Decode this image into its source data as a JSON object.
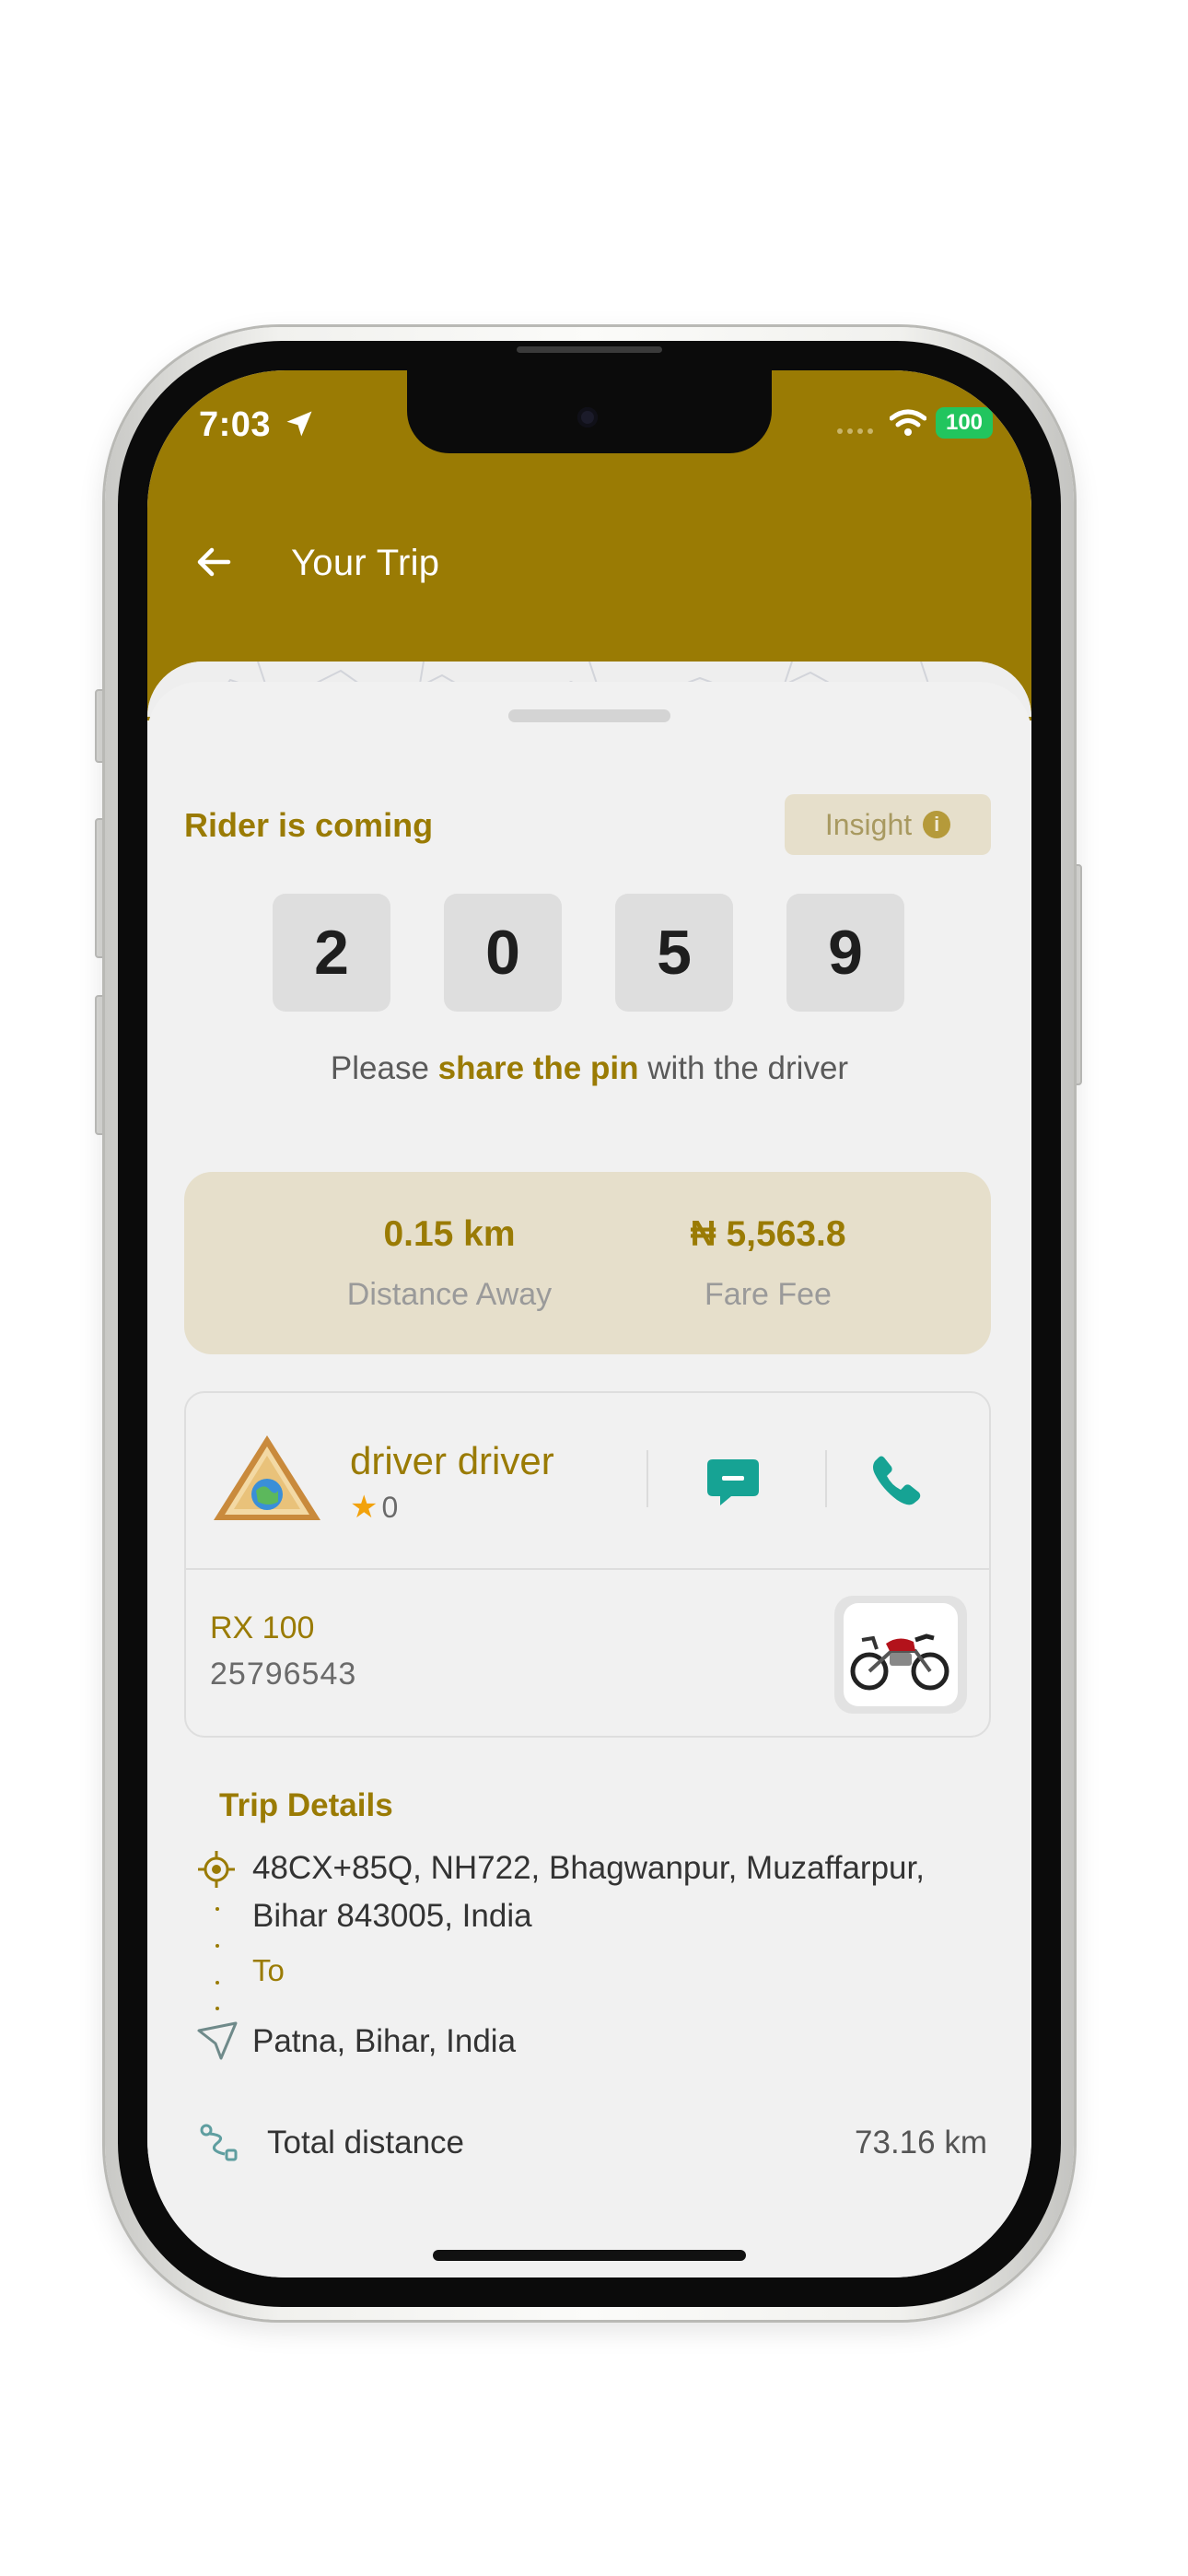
{
  "status_bar": {
    "time": "7:03",
    "battery": "100",
    "icons": [
      "location-arrow-icon",
      "signal-icon",
      "wifi-icon",
      "battery-icon"
    ]
  },
  "header": {
    "title": "Your Trip",
    "back_icon": "arrow-left-icon"
  },
  "trip_status": {
    "label": "Rider is coming",
    "insight_label": "Insight",
    "insight_icon": "info-icon"
  },
  "pin": {
    "digits": [
      "2",
      "0",
      "5",
      "9"
    ],
    "note_prefix": "Please ",
    "note_emphasis": "share the pin",
    "note_suffix": " with the driver"
  },
  "summary": {
    "distance_value": "0.15 km",
    "distance_label": "Distance Away",
    "fare_value": "₦ 5,563.8",
    "fare_label": "Fare Fee"
  },
  "driver": {
    "name": "driver driver",
    "rating": "0",
    "chat_icon": "chat-icon",
    "call_icon": "phone-icon"
  },
  "vehicle": {
    "model": "RX 100",
    "plate": "25796543",
    "image_icon": "motorcycle-icon"
  },
  "trip_details": {
    "title": "Trip Details",
    "pickup": "48CX+85Q, NH722, Bhagwanpur, Muzaffarpur, Bihar 843005, India",
    "to_label": "To",
    "dropoff": "Patna, Bihar, India",
    "total_distance_label": "Total distance",
    "total_distance_value": "73.16 km"
  },
  "colors": {
    "brand": "#9a7b04",
    "accent_teal": "#16a394",
    "card_beige": "#e6dfcb",
    "background": "#f1f1f1",
    "star": "#f2a20c"
  }
}
